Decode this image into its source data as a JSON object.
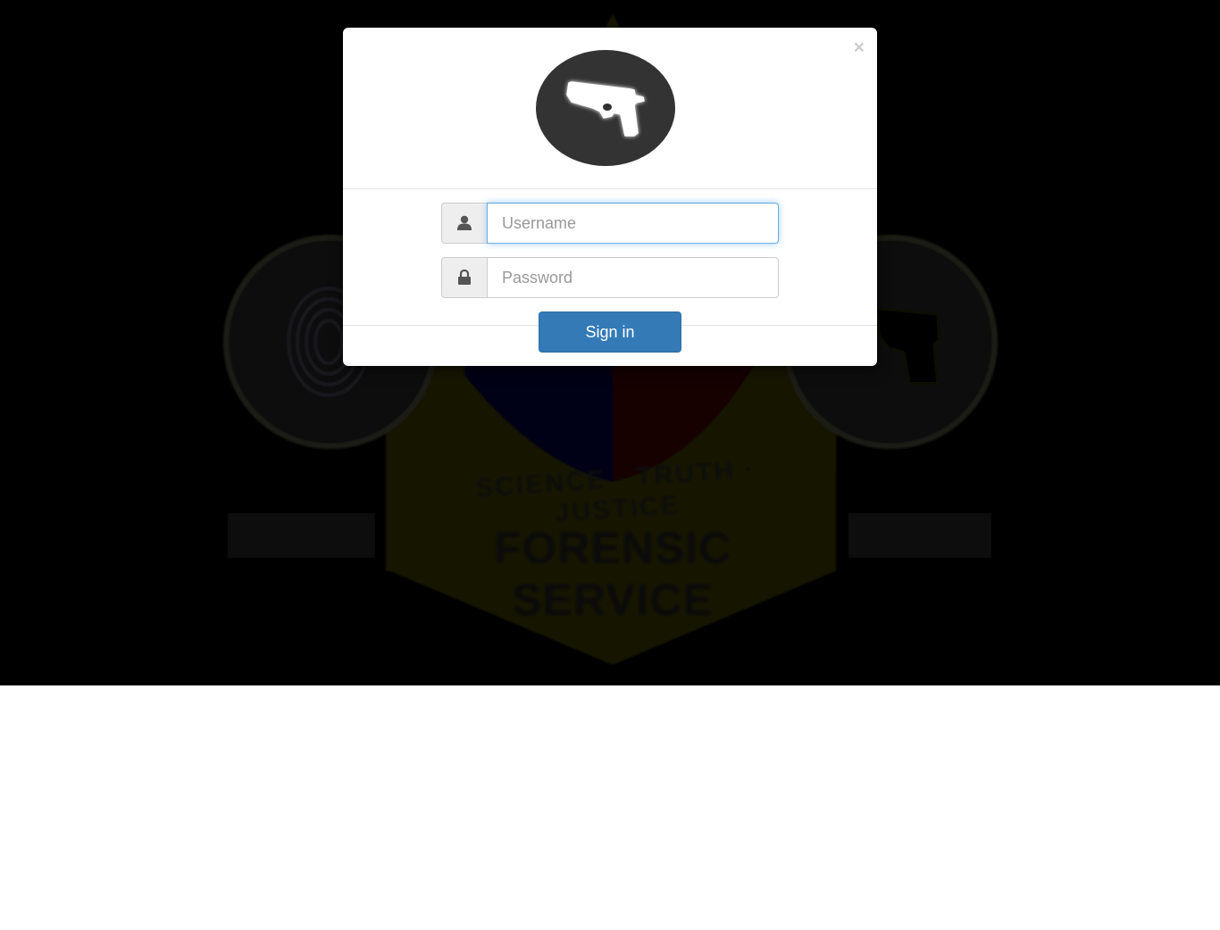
{
  "background": {
    "title": "FORENSIC SERVICE",
    "motto": "SCIENCE · TRUTH · JUSTICE"
  },
  "modal": {
    "close_label": "×",
    "logo_icon": "pistol-icon",
    "username": {
      "value": "",
      "placeholder": "Username",
      "icon": "user-icon"
    },
    "password": {
      "value": "",
      "placeholder": "Password",
      "icon": "lock-icon"
    },
    "signin_label": "Sign in"
  },
  "colors": {
    "primary": "#337ab7",
    "focus": "#66afe9",
    "logo_bg": "#333333"
  }
}
